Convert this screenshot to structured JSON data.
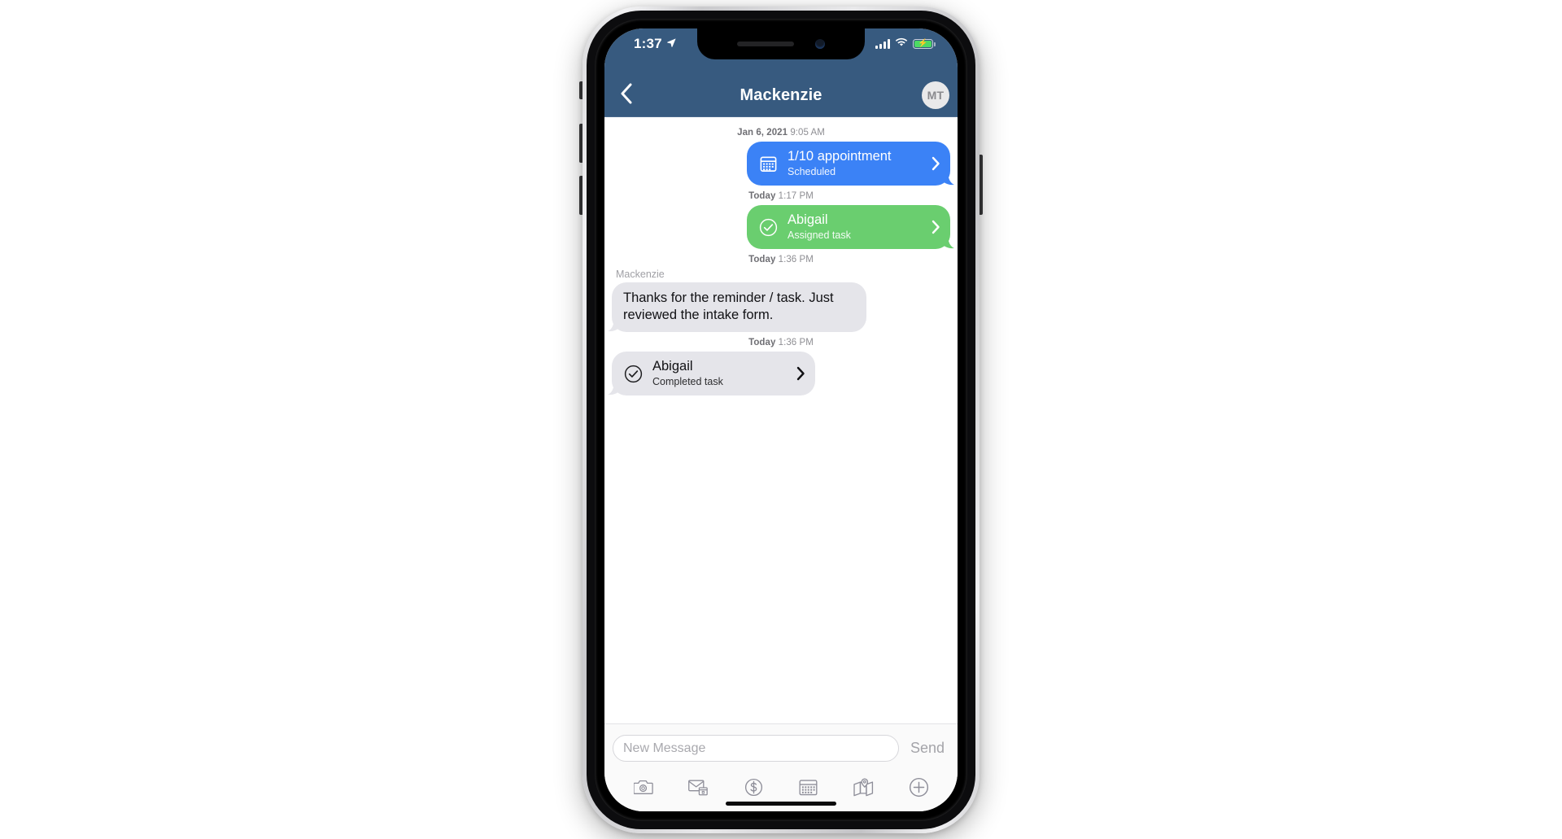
{
  "status_bar": {
    "time": "1:37",
    "location_icon": "location-arrow-icon",
    "signal_icon": "cellular-signal-icon",
    "wifi_icon": "wifi-icon",
    "battery_icon": "battery-charging-icon",
    "battery_charging": true
  },
  "header": {
    "back_icon": "chevron-left-icon",
    "title": "Mackenzie",
    "avatar_initials": "MT"
  },
  "thread": {
    "entries": [
      {
        "kind": "timestamp",
        "date_label": "Jan 6, 2021",
        "time_label": "9:05 AM"
      },
      {
        "kind": "card",
        "direction": "outgoing",
        "style": "blue",
        "icon": "calendar-icon",
        "title": "1/10 appointment",
        "subtitle": "Scheduled",
        "chevron": "chevron-right-icon"
      },
      {
        "kind": "timestamp",
        "date_label": "Today",
        "time_label": "1:17 PM"
      },
      {
        "kind": "card",
        "direction": "outgoing",
        "style": "green",
        "icon": "check-circle-icon",
        "title": "Abigail",
        "subtitle": "Assigned task",
        "chevron": "chevron-right-icon"
      },
      {
        "kind": "timestamp",
        "date_label": "Today",
        "time_label": "1:36 PM"
      },
      {
        "kind": "text",
        "direction": "incoming",
        "sender": "Mackenzie",
        "body": "Thanks for the reminder / task. Just reviewed the intake form."
      },
      {
        "kind": "timestamp",
        "date_label": "Today",
        "time_label": "1:36 PM"
      },
      {
        "kind": "card",
        "direction": "incoming",
        "style": "gray",
        "icon": "check-circle-icon",
        "title": "Abigail",
        "subtitle": "Completed task",
        "chevron": "chevron-right-icon"
      }
    ]
  },
  "composer": {
    "placeholder": "New Message",
    "value": "",
    "send_label": "Send"
  },
  "toolbar": {
    "items": [
      {
        "icon": "camera-icon",
        "label": "Camera"
      },
      {
        "icon": "envelope-calendar-icon",
        "label": "Email template"
      },
      {
        "icon": "dollar-circle-icon",
        "label": "Payment"
      },
      {
        "icon": "calendar-icon",
        "label": "Calendar"
      },
      {
        "icon": "map-pin-icon",
        "label": "Location"
      },
      {
        "icon": "plus-circle-icon",
        "label": "More"
      }
    ]
  },
  "colors": {
    "header_blue": "#375A7F",
    "bubble_blue": "#3b82f6",
    "bubble_green": "#6ace6f",
    "bubble_gray": "#e5e5ea",
    "battery_green": "#4cd964",
    "timestamp_gray": "#8e8e93"
  }
}
